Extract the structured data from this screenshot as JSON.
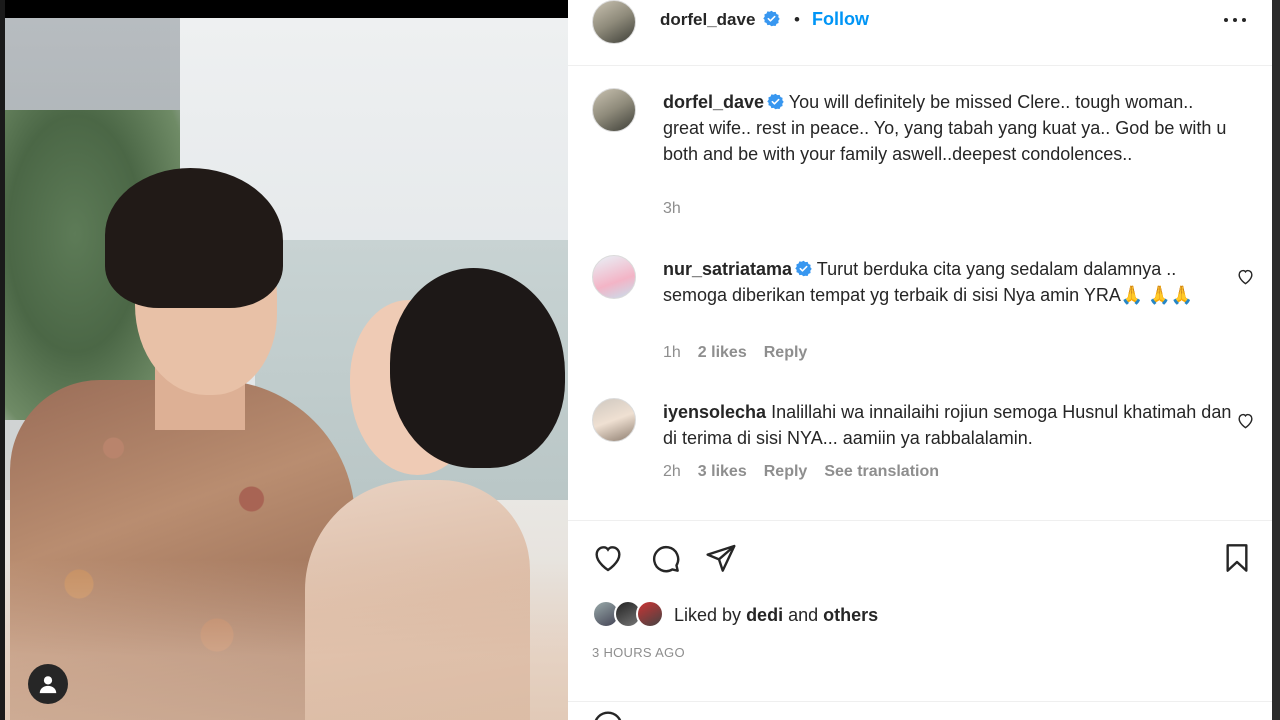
{
  "post": {
    "author": "dorfel_dave",
    "follow_label": "Follow",
    "separator": "•"
  },
  "comments": [
    {
      "user": "dorfel_dave",
      "verified": true,
      "text": "You will definitely be missed Clere.. tough woman.. great wife.. rest in peace.. Yo, yang tabah yang kuat ya.. God be with u both and be with your family aswell..deepest condolences..",
      "time": "3h"
    },
    {
      "user": "nur_satriatama",
      "verified": true,
      "text": "Turut berduka cita yang sedalam dalamnya .. semoga diberikan tempat yg terbaik di sisi Nya amin YRA🙏 🙏🙏",
      "time": "1h",
      "likes": "2 likes",
      "reply": "Reply"
    },
    {
      "user": "iyensolecha",
      "verified": false,
      "text": "Inalillahi wa innailaihi rojiun semoga Husnul khatimah dan di terima di sisi NYA... aamiin ya rabbalalamin.",
      "time": "2h",
      "likes": "3 likes",
      "reply": "Reply",
      "translate": "See translation"
    }
  ],
  "likes_summary": {
    "prefix": "Liked by",
    "user": "dedi",
    "and": "and",
    "others": "others"
  },
  "timestamp": "3 HOURS AGO",
  "colors": {
    "accent": "#0095f6",
    "text": "#262626",
    "muted": "#8e8e8e"
  }
}
